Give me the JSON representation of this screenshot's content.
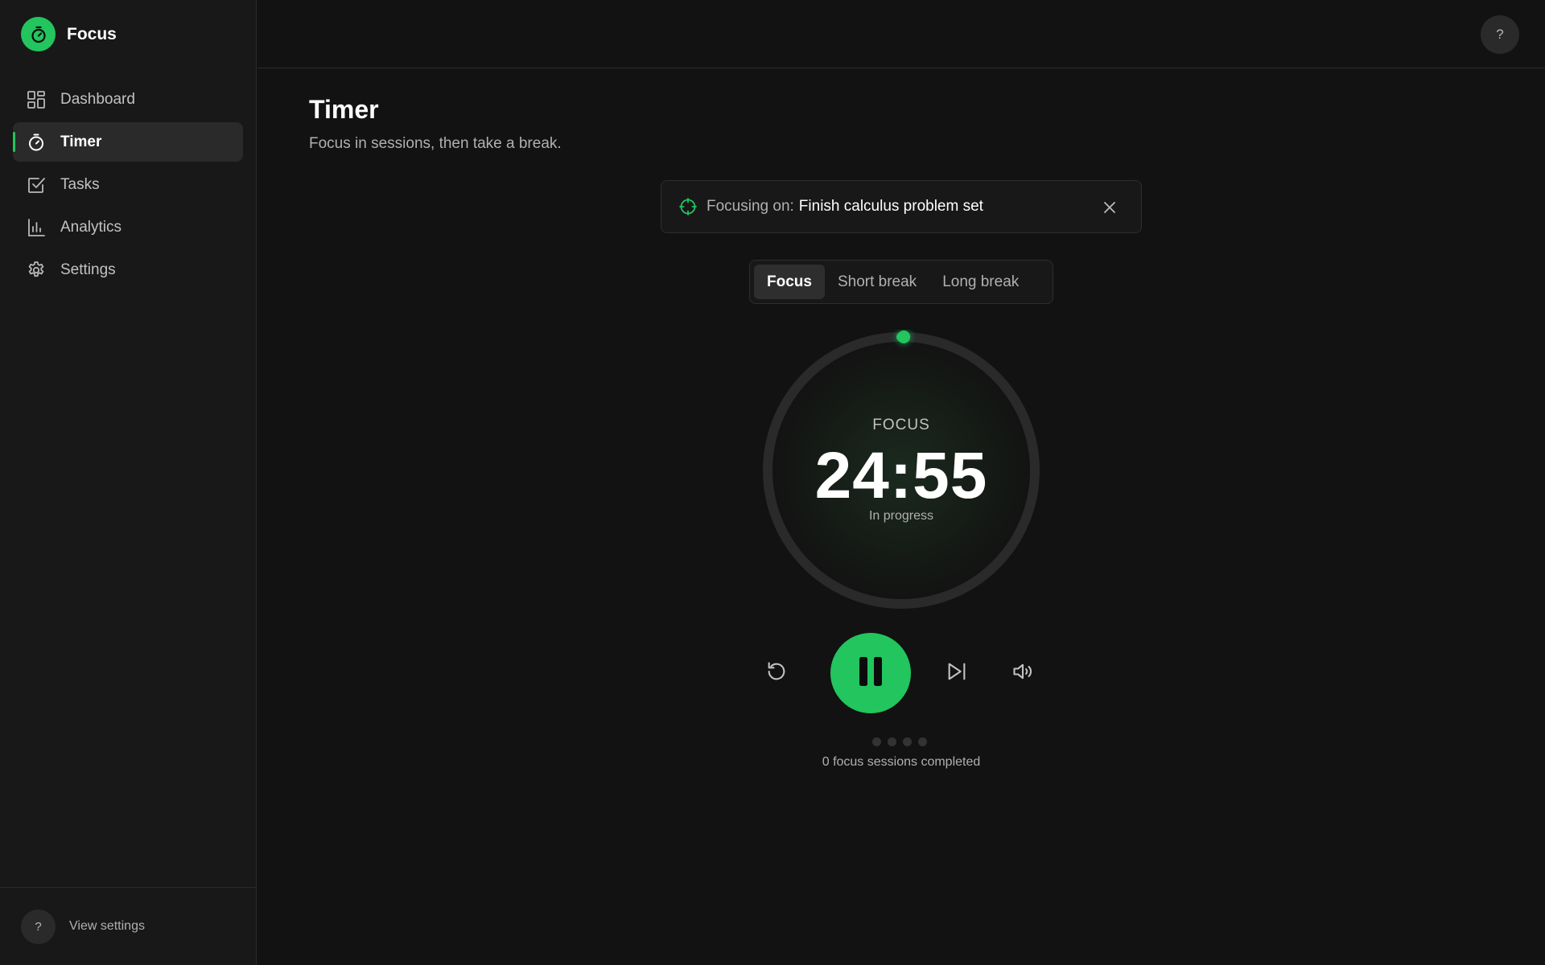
{
  "app": {
    "name": "Focus",
    "accent": "#22c55e"
  },
  "sidebar": {
    "items": [
      {
        "label": "Dashboard",
        "icon": "dashboard-icon",
        "active": false
      },
      {
        "label": "Timer",
        "icon": "timer-icon",
        "active": true
      },
      {
        "label": "Tasks",
        "icon": "tasks-icon",
        "active": false
      },
      {
        "label": "Analytics",
        "icon": "analytics-icon",
        "active": false
      },
      {
        "label": "Settings",
        "icon": "settings-icon",
        "active": false
      }
    ],
    "footer": {
      "help_glyph": "?",
      "label": "View settings"
    }
  },
  "header": {
    "help_glyph": "?"
  },
  "page": {
    "title": "Timer",
    "subtitle": "Focus in sessions, then take a break."
  },
  "focus_banner": {
    "prefix": "Focusing on:",
    "task": "Finish calculus problem set"
  },
  "mode_tabs": [
    {
      "label": "Focus",
      "active": true
    },
    {
      "label": "Short break",
      "active": false
    },
    {
      "label": "Long break",
      "active": false
    }
  ],
  "timer": {
    "label": "FOCUS",
    "value": "24:55",
    "status": "In progress",
    "progress_fraction": 0.003,
    "ring_color": "#2a2a2a",
    "progress_color": "#22c55e"
  },
  "controls": {
    "reset_icon": "reset-icon",
    "pause_icon": "pause-icon",
    "skip_icon": "skip-icon",
    "volume_icon": "volume-icon"
  },
  "sessions": {
    "dots_total": 4,
    "completed": 0,
    "text": "0 focus sessions completed"
  }
}
